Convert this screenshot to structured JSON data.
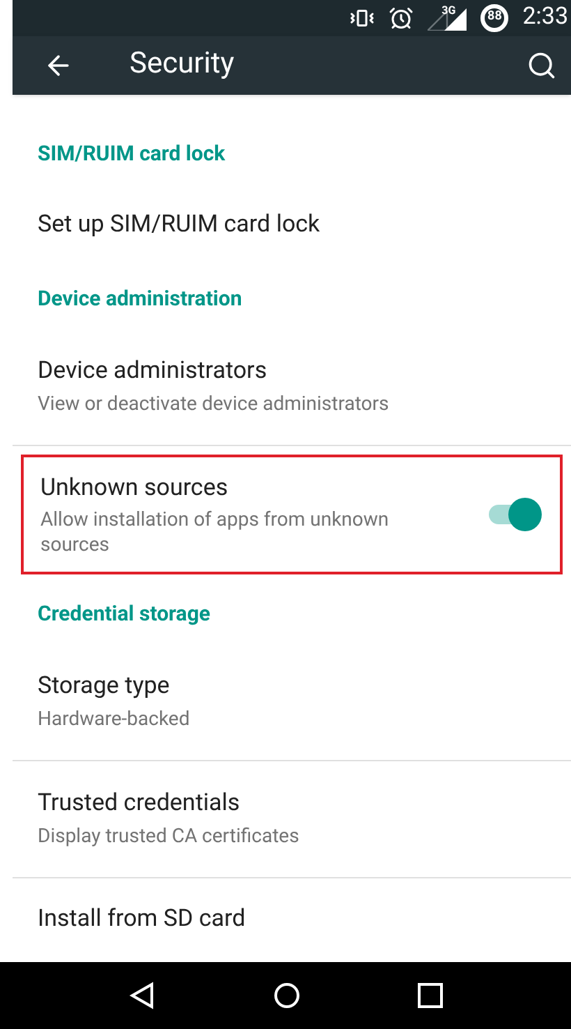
{
  "status_bar": {
    "signal_label": "3G",
    "battery": "88",
    "time": "2:33"
  },
  "toolbar": {
    "title": "Security"
  },
  "items": [
    {
      "kind": "header",
      "title": "SIM/RUIM card lock"
    },
    {
      "kind": "item",
      "title": "Set up SIM/RUIM card lock",
      "divider": false
    },
    {
      "kind": "header",
      "title": "Device administration"
    },
    {
      "kind": "item",
      "title": "Device administrators",
      "summary": "View or deactivate device administrators",
      "divider": true
    },
    {
      "kind": "toggle",
      "title": "Unknown sources",
      "summary": "Allow installation of apps from unknown sources",
      "on": true,
      "highlighted": true
    },
    {
      "kind": "header",
      "title": "Credential storage"
    },
    {
      "kind": "item",
      "title": "Storage type",
      "summary": "Hardware-backed",
      "divider": true
    },
    {
      "kind": "item",
      "title": "Trusted credentials",
      "summary": "Display trusted CA certificates",
      "divider": true
    },
    {
      "kind": "item",
      "title": "Install from SD card",
      "divider": false
    }
  ]
}
